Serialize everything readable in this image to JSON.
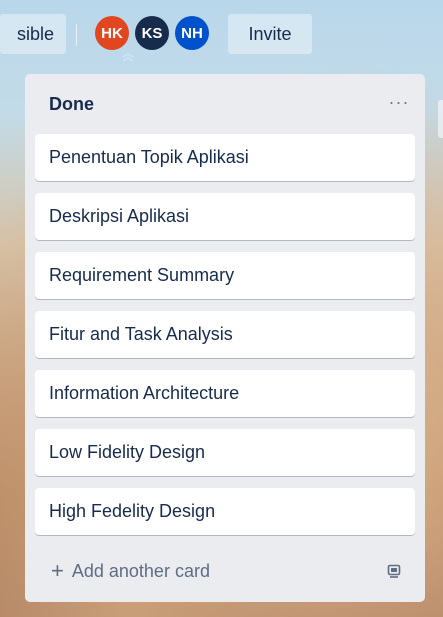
{
  "header": {
    "visibility_label": "sible",
    "invite_label": "Invite",
    "members": [
      {
        "initials": "HK",
        "color": "#e1461f"
      },
      {
        "initials": "KS",
        "color": "#172b4d"
      },
      {
        "initials": "NH",
        "color": "#0052cc"
      }
    ]
  },
  "list": {
    "title": "Done",
    "menu_label": "···",
    "cards": [
      "Penentuan Topik Aplikasi",
      "Deskripsi Aplikasi",
      "Requirement Summary",
      "Fitur and Task Analysis",
      "Information Architecture",
      "Low Fidelity Design",
      "High Fedelity Design"
    ],
    "add_card_label": "Add another card",
    "add_card_icon": "plus-icon",
    "template_icon": "card-template-icon"
  },
  "colors": {
    "list_bg": "#ebecf0",
    "card_bg": "#ffffff",
    "text": "#172b4d",
    "muted": "#5e6c84"
  }
}
